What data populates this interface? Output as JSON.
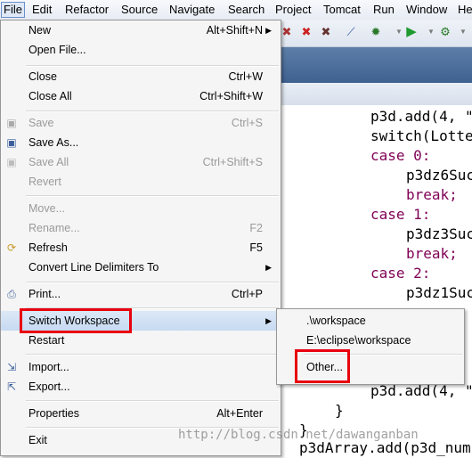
{
  "menubar": [
    "File",
    "Edit",
    "Refactor",
    "Source",
    "Navigate",
    "Search",
    "Project",
    "Tomcat",
    "Run",
    "Window",
    "He"
  ],
  "file_menu": {
    "new": {
      "label": "New",
      "accel": "Alt+Shift+N"
    },
    "open_file": {
      "label": "Open File..."
    },
    "close": {
      "label": "Close",
      "accel": "Ctrl+W"
    },
    "close_all": {
      "label": "Close All",
      "accel": "Ctrl+Shift+W"
    },
    "save": {
      "label": "Save",
      "accel": "Ctrl+S"
    },
    "save_as": {
      "label": "Save As..."
    },
    "save_all": {
      "label": "Save All",
      "accel": "Ctrl+Shift+S"
    },
    "revert": {
      "label": "Revert"
    },
    "move": {
      "label": "Move..."
    },
    "rename": {
      "label": "Rename...",
      "accel": "F2"
    },
    "refresh": {
      "label": "Refresh",
      "accel": "F5"
    },
    "convert": {
      "label": "Convert Line Delimiters To"
    },
    "print": {
      "label": "Print...",
      "accel": "Ctrl+P"
    },
    "switch_workspace": {
      "label": "Switch Workspace"
    },
    "restart": {
      "label": "Restart"
    },
    "import": {
      "label": "Import..."
    },
    "export": {
      "label": "Export..."
    },
    "properties": {
      "label": "Properties",
      "accel": "Alt+Enter"
    },
    "exit": {
      "label": "Exit"
    }
  },
  "submenu": {
    "ws1": ".\\workspace",
    "ws2": "E:\\eclipse\\workspace",
    "other": "Other..."
  },
  "editor": {
    "lines": [
      "p3d.add(4, \"",
      "switch(Lotte",
      "case 0:",
      "p3dz6Suc",
      "break;",
      "case 1:",
      "p3dz3Suc",
      "break;",
      "case 2:",
      "p3dz1Suc",
      "p3d.add(4, \"",
      "}",
      "}",
      "p3dArray.add(p3d_num"
    ]
  },
  "watermark": "http://blog.csdn.net/dawanganban",
  "colors": {
    "highlight_box": "#e8000e",
    "keyword": "#7f0055"
  }
}
